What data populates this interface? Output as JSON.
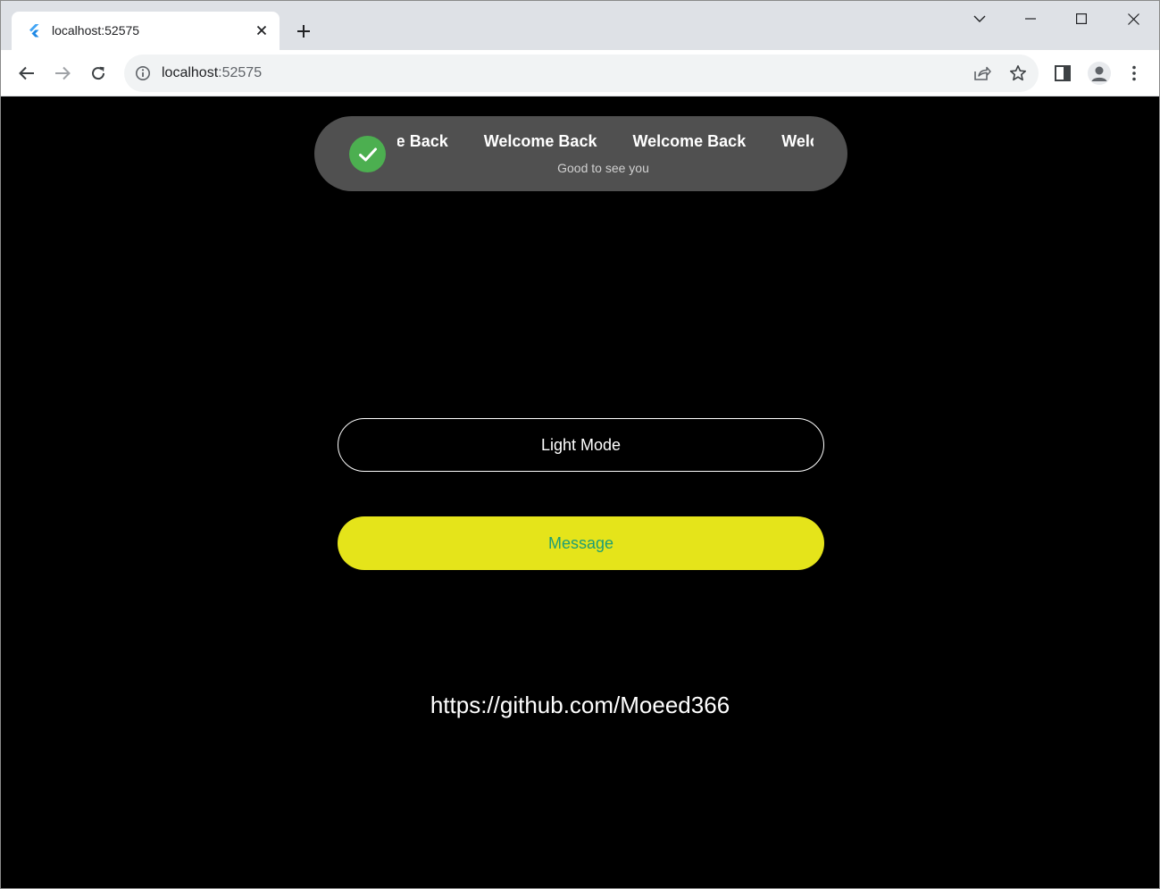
{
  "browser": {
    "tab": {
      "title": "localhost:52575"
    },
    "omnibox": {
      "host": "localhost",
      "port": ":52575"
    }
  },
  "toast": {
    "marquee_items": [
      "Welcome Back",
      "Welcome Back",
      "Welcome Back",
      "Welcome Back"
    ],
    "subtitle": "Good to see you",
    "accent_color": "#4caf50"
  },
  "main": {
    "light_mode_label": "Light Mode",
    "message_label": "Message",
    "message_bg_color": "#e5e41a",
    "message_text_color": "#1e9e75",
    "github_link": "https://github.com/Moeed366"
  }
}
